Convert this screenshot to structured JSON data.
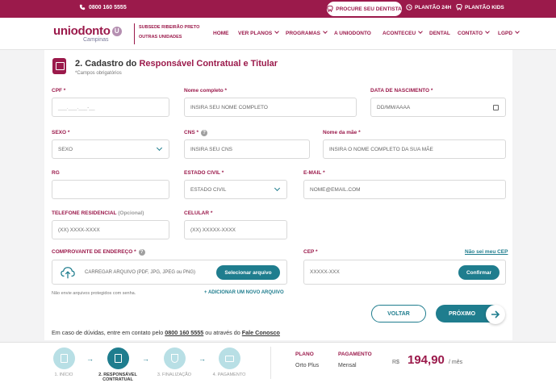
{
  "topbar": {
    "phone": "0800 160 5555",
    "find_dentist": "PROCURE SEU DENTISTA",
    "plantao24": "PLANTÃO 24H",
    "plantao_kids": "PLANTÃO KIDS"
  },
  "nav": {
    "logo_text": "uniodonto",
    "logo_badge": "U",
    "logo_sub": "Campinas",
    "subsede": "SUBSEDE RIBEIRÃO PRETO",
    "outras": "OUTRAS UNIDADES",
    "items": [
      "HOME",
      "VER PLANOS",
      "PROGRAMAS",
      "A UNIODONTO",
      "ACONTECEU",
      "DENTAL",
      "CONTATO",
      "LGPD"
    ]
  },
  "section": {
    "title_prefix": "2. Cadastro do ",
    "title_highlight": "Responsável Contratual e Titular",
    "required_note": "*Campos obrigatórios"
  },
  "form": {
    "cpf": {
      "label": "CPF *",
      "placeholder": "___.___.___-__"
    },
    "nome": {
      "label": "Nome completo *",
      "placeholder": "INSIRA SEU NOME COMPLETO"
    },
    "nascimento": {
      "label": "DATA DE NASCIMENTO *",
      "placeholder": "DD/MM/AAAA"
    },
    "sexo": {
      "label": "SEXO *",
      "value": "SEXO"
    },
    "cns": {
      "label": "CNS *",
      "placeholder": "INSIRA SEU CNS"
    },
    "mae": {
      "label": "Nome da mãe *",
      "placeholder": "INSIRA O NOME COMPLETO DA SUA MÃE"
    },
    "rg": {
      "label": "RG",
      "placeholder": ""
    },
    "estado_civil": {
      "label": "ESTADO CIVIL *",
      "value": "ESTADO CIVIL"
    },
    "email": {
      "label": "E-MAIL *",
      "placeholder": "NOME@EMAIL.COM"
    },
    "tel_res": {
      "label": "TELEFONE RESIDENCIAL",
      "optional": "(Opcional)",
      "placeholder": "(XX) XXXX-XXXX"
    },
    "celular": {
      "label": "CELULAR *",
      "placeholder": "(XX) XXXXX-XXXX"
    },
    "comprovante": {
      "label": "COMPROVANTE DE ENDEREÇO *",
      "upload_text": "CARREGAR ARQUIVO (PDF, JPG, JPEG ou PNG)",
      "button": "Selecionar arquivo",
      "note": "Não envie arquivos protegidos com senha.",
      "add": "+ ADICIONAR UM NOVO ARQUIVO"
    },
    "cep": {
      "label": "CEP *",
      "placeholder": "XXXXX-XXX",
      "button": "Confirmar",
      "link": "Não sei meu CEP"
    }
  },
  "actions": {
    "back": "VOLTAR",
    "next": "PRÓXIMO"
  },
  "contact": {
    "prefix": "Em caso de dúvidas, entre em contato pelo ",
    "phone": "0800 160 5555",
    "middle": " ou através do ",
    "link": "Fale Conosco"
  },
  "steps": [
    {
      "label": "1. INÍCIO"
    },
    {
      "label": "2. RESPONSÁVEL CONTRATUAL"
    },
    {
      "label": "3. FINALIZAÇÃO"
    },
    {
      "label": "4. PAGAMENTO"
    }
  ],
  "summary": {
    "plano_label": "PLANO",
    "plano_value": "Orto Plus",
    "pagamento_label": "PAGAMENTO",
    "pagamento_value": "Mensal",
    "currency": "R$",
    "price": "194,90",
    "per": "/ mês"
  },
  "colors": {
    "brand": "#9b1a4b",
    "accent": "#1f7d8e",
    "step_inactive": "#b8dfe5"
  }
}
